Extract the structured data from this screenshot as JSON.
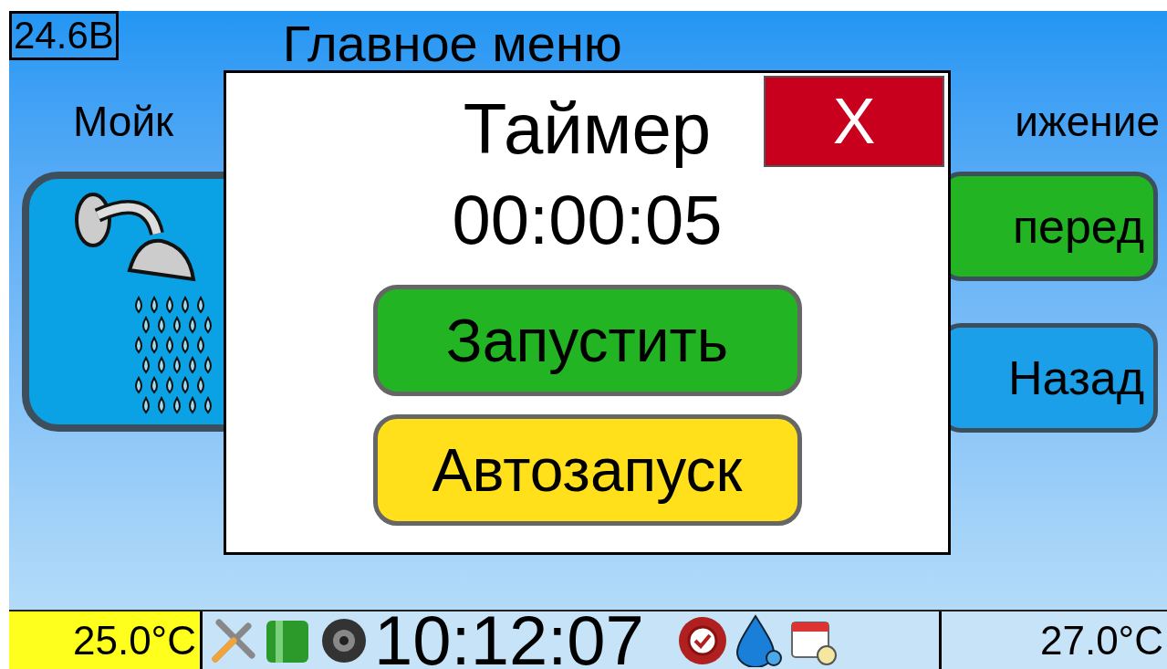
{
  "header": {
    "voltage": "24.6В",
    "title": "Главное меню"
  },
  "sections": [
    {
      "label": "Мойк"
    },
    {
      "label": "ижение"
    }
  ],
  "buttons": [
    {
      "kind": "shower"
    },
    {
      "kind": "green",
      "label": "перед"
    },
    {
      "kind": "blue",
      "label": "Назад"
    }
  ],
  "dialog": {
    "title": "Таймер",
    "close": "X",
    "time": "00:00:05",
    "actions": [
      {
        "kind": "green",
        "label": "Запустить"
      },
      {
        "kind": "yellow",
        "label": "Автозапуск"
      }
    ]
  },
  "status_bar": {
    "temp_left": "25.0°C",
    "time": "10:12:07",
    "temp_right": "27.0°C"
  }
}
